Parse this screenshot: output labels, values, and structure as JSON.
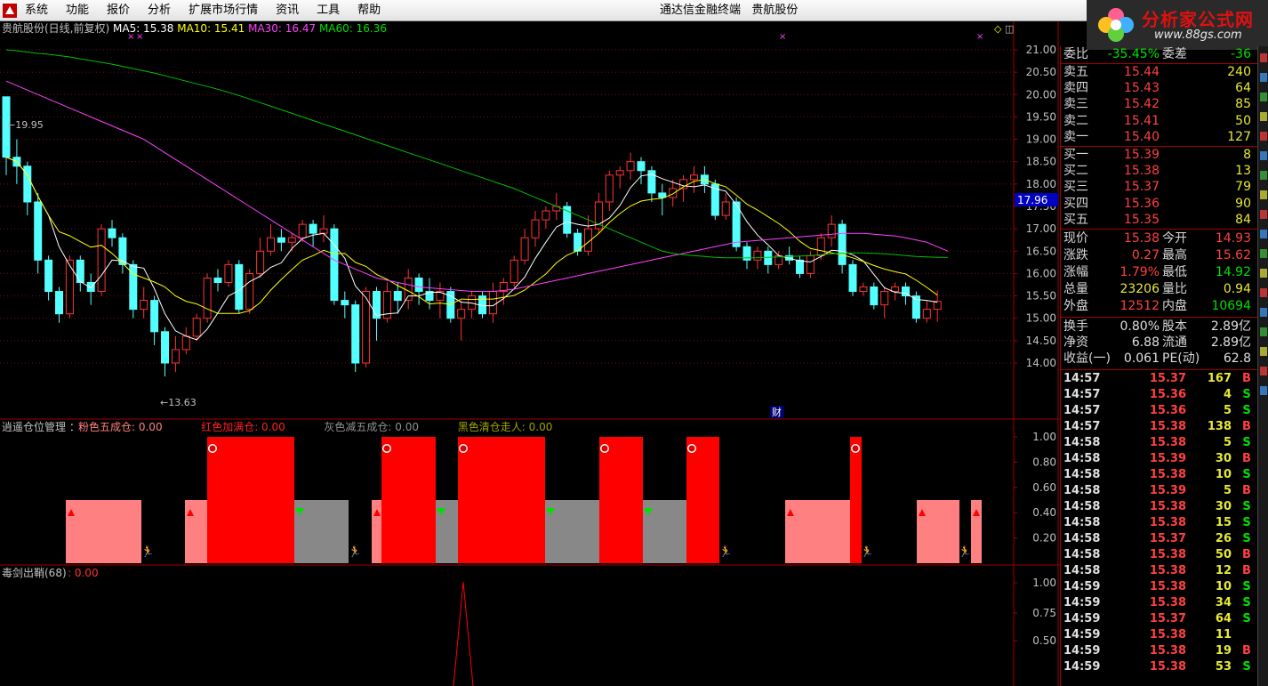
{
  "menu": {
    "items": [
      "系统",
      "功能",
      "报价",
      "分析",
      "扩展市场行情",
      "资讯",
      "工具",
      "帮助"
    ],
    "title": "通达信金融终端   贵航股份"
  },
  "watermark": {
    "name": "分析家公式网",
    "url": "www.88gs.com"
  },
  "main_chart": {
    "stock_label": "贵航股份(日线,前复权)",
    "ma": [
      {
        "label": "MA5: 15.38",
        "color": "#ffffff"
      },
      {
        "label": "MA10: 15.41",
        "color": "#ffff00"
      },
      {
        "label": "MA30: 16.47",
        "color": "#ff40ff"
      },
      {
        "label": "MA60: 16.36",
        "color": "#00e000"
      }
    ],
    "high_label": "19.95",
    "low_label": "13.63",
    "current_price_label": "17.96",
    "cai_marker": "财"
  },
  "position_indicator": {
    "title": "逍遥仓位管理 ：",
    "items": [
      {
        "label": "粉色五成仓: 0.00",
        "color": "#ff8080"
      },
      {
        "label": "红色加满仓: 0.00",
        "color": "#ff2020"
      },
      {
        "label": "灰色减五成仓: 0.00",
        "color": "#909090"
      },
      {
        "label": "黑色清仓走人: 0.00",
        "color": "#a0a000"
      }
    ]
  },
  "sword_indicator": {
    "title": "毒剑出鞘(68)",
    "value": ": 0.00"
  },
  "quote": {
    "weibi": {
      "label": "委比",
      "value": "-35.45%",
      "label2": "委差",
      "value2": "-36"
    },
    "sell": [
      {
        "label": "卖五",
        "price": "15.44",
        "vol": "240"
      },
      {
        "label": "卖四",
        "price": "15.43",
        "vol": "64"
      },
      {
        "label": "卖三",
        "price": "15.42",
        "vol": "85"
      },
      {
        "label": "卖二",
        "price": "15.41",
        "vol": "50"
      },
      {
        "label": "卖一",
        "price": "15.40",
        "vol": "127"
      }
    ],
    "buy": [
      {
        "label": "买一",
        "price": "15.39",
        "vol": "8"
      },
      {
        "label": "买二",
        "price": "15.38",
        "vol": "13"
      },
      {
        "label": "买三",
        "price": "15.37",
        "vol": "79"
      },
      {
        "label": "买四",
        "price": "15.36",
        "vol": "90"
      },
      {
        "label": "买五",
        "price": "15.35",
        "vol": "84"
      }
    ],
    "stats": [
      {
        "l1": "现价",
        "v1": "15.38",
        "l2": "今开",
        "v2": "14.93",
        "c1": "#ff4040",
        "c2": "#ff4040"
      },
      {
        "l1": "涨跌",
        "v1": "0.27",
        "l2": "最高",
        "v2": "15.62",
        "c1": "#ff4040",
        "c2": "#ff4040"
      },
      {
        "l1": "涨幅",
        "v1": "1.79%",
        "l2": "最低",
        "v2": "14.92",
        "c1": "#ff4040",
        "c2": "#00e000"
      },
      {
        "l1": "总量",
        "v1": "23206",
        "l2": "量比",
        "v2": "0.94",
        "c1": "#e8e838",
        "c2": "#e8e838"
      },
      {
        "l1": "外盘",
        "v1": "12512",
        "l2": "内盘",
        "v2": "10694",
        "c1": "#ff4040",
        "c2": "#00e000"
      }
    ],
    "fundamentals": [
      {
        "l1": "换手",
        "v1": "0.80%",
        "l2": "股本",
        "v2": "2.89亿"
      },
      {
        "l1": "净资",
        "v1": "6.88",
        "l2": "流通",
        "v2": "2.89亿"
      },
      {
        "l1": "收益(一)",
        "v1": "0.061",
        "l2": "PE(动)",
        "v2": "62.8"
      }
    ]
  },
  "ticks": [
    {
      "t": "14:57",
      "p": "15.37",
      "v": "167",
      "bs": "B"
    },
    {
      "t": "14:57",
      "p": "15.36",
      "v": "4",
      "bs": "S"
    },
    {
      "t": "14:57",
      "p": "15.36",
      "v": "5",
      "bs": "S"
    },
    {
      "t": "14:57",
      "p": "15.38",
      "v": "138",
      "bs": "B"
    },
    {
      "t": "14:58",
      "p": "15.38",
      "v": "5",
      "bs": "S"
    },
    {
      "t": "14:58",
      "p": "15.39",
      "v": "30",
      "bs": "B"
    },
    {
      "t": "14:58",
      "p": "15.38",
      "v": "10",
      "bs": "S"
    },
    {
      "t": "14:58",
      "p": "15.39",
      "v": "5",
      "bs": "B"
    },
    {
      "t": "14:58",
      "p": "15.38",
      "v": "30",
      "bs": "S"
    },
    {
      "t": "14:58",
      "p": "15.38",
      "v": "15",
      "bs": "S"
    },
    {
      "t": "14:58",
      "p": "15.37",
      "v": "26",
      "bs": "S"
    },
    {
      "t": "14:58",
      "p": "15.38",
      "v": "50",
      "bs": "B"
    },
    {
      "t": "14:58",
      "p": "15.38",
      "v": "12",
      "bs": "B"
    },
    {
      "t": "14:59",
      "p": "15.38",
      "v": "10",
      "bs": "S"
    },
    {
      "t": "14:59",
      "p": "15.38",
      "v": "34",
      "bs": "S"
    },
    {
      "t": "14:59",
      "p": "15.37",
      "v": "64",
      "bs": "S"
    },
    {
      "t": "14:59",
      "p": "15.38",
      "v": "11",
      "bs": ""
    },
    {
      "t": "14:59",
      "p": "15.38",
      "v": "19",
      "bs": "B"
    },
    {
      "t": "14:59",
      "p": "15.38",
      "v": "53",
      "bs": "S"
    }
  ],
  "colors": {
    "up": "#ff3232",
    "down": "#54ffff",
    "buy": "#ff4040",
    "sell": "#00e000",
    "grid": "#a00000"
  }
}
